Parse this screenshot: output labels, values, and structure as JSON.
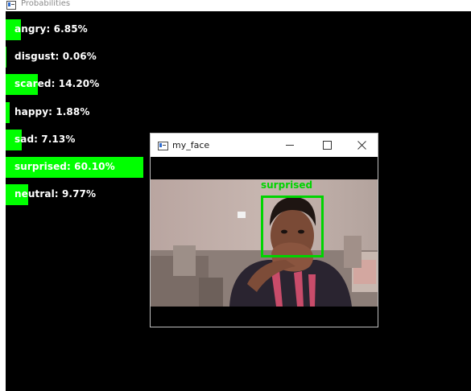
{
  "main_window": {
    "title": "Probabilities"
  },
  "probabilities": [
    {
      "label": "angry: 6.85%",
      "value": 6.85
    },
    {
      "label": "disgust: 0.06%",
      "value": 0.06
    },
    {
      "label": "scared: 14.20%",
      "value": 14.2
    },
    {
      "label": "happy: 1.88%",
      "value": 1.88
    },
    {
      "label": "sad: 7.13%",
      "value": 7.13
    },
    {
      "label": "surprised: 60.10%",
      "value": 60.1
    },
    {
      "label": "neutral: 9.77%",
      "value": 9.77
    }
  ],
  "face_window": {
    "title": "my_face",
    "detected_label": "surprised"
  },
  "colors": {
    "bar": "#00ff00",
    "box": "#00d400",
    "canvas": "#000000"
  },
  "icons": {
    "app": "opencv-window-icon",
    "minimize": "minimize-icon",
    "maximize": "maximize-icon",
    "close": "close-icon"
  }
}
